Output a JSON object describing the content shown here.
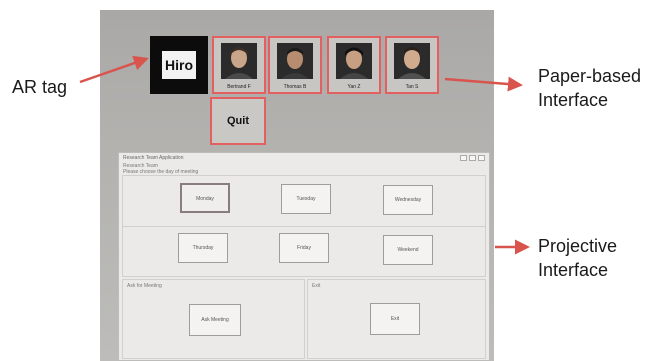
{
  "annotations": {
    "ar_tag": "AR tag",
    "paper_interface": [
      "Paper-based",
      "Interface"
    ],
    "projective_interface": [
      "Projective",
      "Interface"
    ]
  },
  "paper": {
    "ar_tag_text": "Hiro",
    "people": [
      {
        "name": "Bertrand F"
      },
      {
        "name": "Thomas B"
      },
      {
        "name": "Yan Z"
      },
      {
        "name": "Tan S"
      }
    ],
    "quit_label": "Quit"
  },
  "projection": {
    "window_title": "Research Team Application",
    "header": "Research Team",
    "subheader": "Please choose the day of meeting",
    "days": [
      "Monday",
      "Tuesday",
      "Wednesday",
      "Thursday",
      "Friday",
      "Weekend"
    ],
    "ask_panel_title": "Ask for Meeting",
    "ask_button": "Ask Meeting",
    "exit_panel_title": "Exit",
    "exit_button": "Exit"
  },
  "colors": {
    "arrow": "#d9544d",
    "card_border": "#e46060"
  }
}
